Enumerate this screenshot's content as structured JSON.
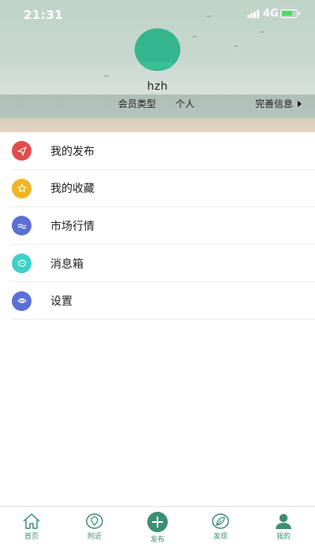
{
  "status_bar": {
    "time": "21:31",
    "network": "4G"
  },
  "profile": {
    "username": "hzh",
    "member_type_label": "会员类型",
    "member_type_value": "个人",
    "complete_info_label": "完善信息"
  },
  "menu": {
    "items": [
      {
        "label": "我的发布",
        "icon": "send-icon",
        "color": "#e44b4b"
      },
      {
        "label": "我的收藏",
        "icon": "star-icon",
        "color": "#f0b523"
      },
      {
        "label": "市场行情",
        "icon": "wave-icon",
        "color": "#5b6fd6"
      },
      {
        "label": "消息箱",
        "icon": "chat-icon",
        "color": "#3fd1c8"
      },
      {
        "label": "设置",
        "icon": "eye-icon",
        "color": "#5b6fd6"
      }
    ]
  },
  "tabbar": {
    "items": [
      {
        "label": "首页",
        "icon": "home-icon"
      },
      {
        "label": "附近",
        "icon": "location-icon"
      },
      {
        "label": "发布",
        "icon": "plus-icon"
      },
      {
        "label": "发现",
        "icon": "leaf-icon"
      },
      {
        "label": "我的",
        "icon": "user-icon",
        "active": true
      }
    ],
    "accent_color": "#3d8f72"
  }
}
